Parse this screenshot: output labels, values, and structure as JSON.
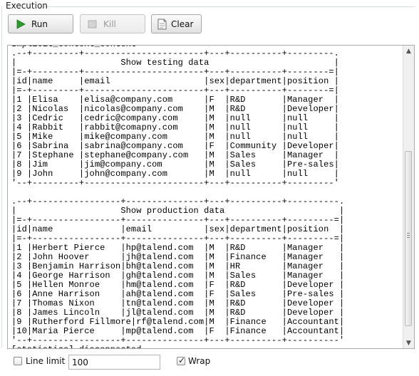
{
  "panel": {
    "title": "Execution"
  },
  "toolbar": {
    "run_label": "Run",
    "kill_label": "Kill",
    "clear_label": "Clear"
  },
  "console": {
    "lines": [
      "Implicit_Context_Context",
      ".--+---------+-----------------------+---+----------+---------.",
      "|                    Show testing data                        |",
      "|=-+---------+-----------------------+---+----------+--------=|",
      "|id|name     |email                  |sex|department|position |",
      "|=-+---------+-----------------------+---+----------+--------=|",
      "|1 |Elisa    |elisa@company.com      |F  |R&D       |Manager  |",
      "|2 |Nicolas  |nicolas@company.com    |M  |R&D       |Developer|",
      "|3 |Cedric   |cedric@company.com     |M  |null      |null     |",
      "|4 |Rabbit   |rabbit@comapny.com     |M  |null      |null     |",
      "|5 |Mike     |mike@company.com       |M  |null      |null     |",
      "|6 |Sabrina  |sabrina@company.com    |F  |Community |Developer|",
      "|7 |Stephane |stephane@company.com   |M  |Sales     |Manager  |",
      "|8 |Jim      |jim@company.com        |M  |Sales     |Pre-sales|",
      "|9 |John     |john@company.com       |M  |null      |null     |",
      "'--+---------+-----------------------+---+----------+---------'",
      "",
      ".--+-----------------+---------------+---+----------+----------.",
      "|                    Show production data                      |",
      "|=-+-----------------+---------------+---+----------+---------=|",
      "|id|name             |email          |sex|department|position  |",
      "|=-+-----------------+---------------+---+----------+---------=|",
      "|1 |Herbert Pierce   |hp@talend.com  |M  |R&D       |Manager   |",
      "|2 |John Hoover      |jh@talend.com  |M  |Finance   |Manager   |",
      "|3 |Benjamin Harrison|bh@talend.com  |M  |HR        |Manager   |",
      "|4 |George Harrison  |gh@talend.com  |M  |Sales     |Manager   |",
      "|5 |Hellen Monroe    |hm@talend.com  |F  |R&D       |Developer |",
      "|6 |Anne Harrison    |ah@talend.com  |F  |Sales     |Pre-sales |",
      "|7 |Thomas Nixon     |tn@talend.com  |M  |R&D       |Developer |",
      "|8 |James Lincoln    |jl@talend.com  |M  |R&D       |Developer |",
      "|9 |Rutherford Fillmore|rf@talend.com|M  |Finance   |Accountant|",
      "|10|Maria Pierce     |mp@talend.com  |F  |Finance   |Accountant|",
      "'--+-----------------+---------------+---+----------+----------'",
      "[statistics] disconnected"
    ]
  },
  "bottom": {
    "line_limit_label": "Line limit",
    "line_limit_checked": false,
    "line_limit_value": "100",
    "wrap_label": "Wrap",
    "wrap_checked": true
  },
  "icons": {
    "run": "play-icon",
    "kill": "stop-icon",
    "clear": "clear-document-icon",
    "run_color": "#2e9a2e"
  }
}
